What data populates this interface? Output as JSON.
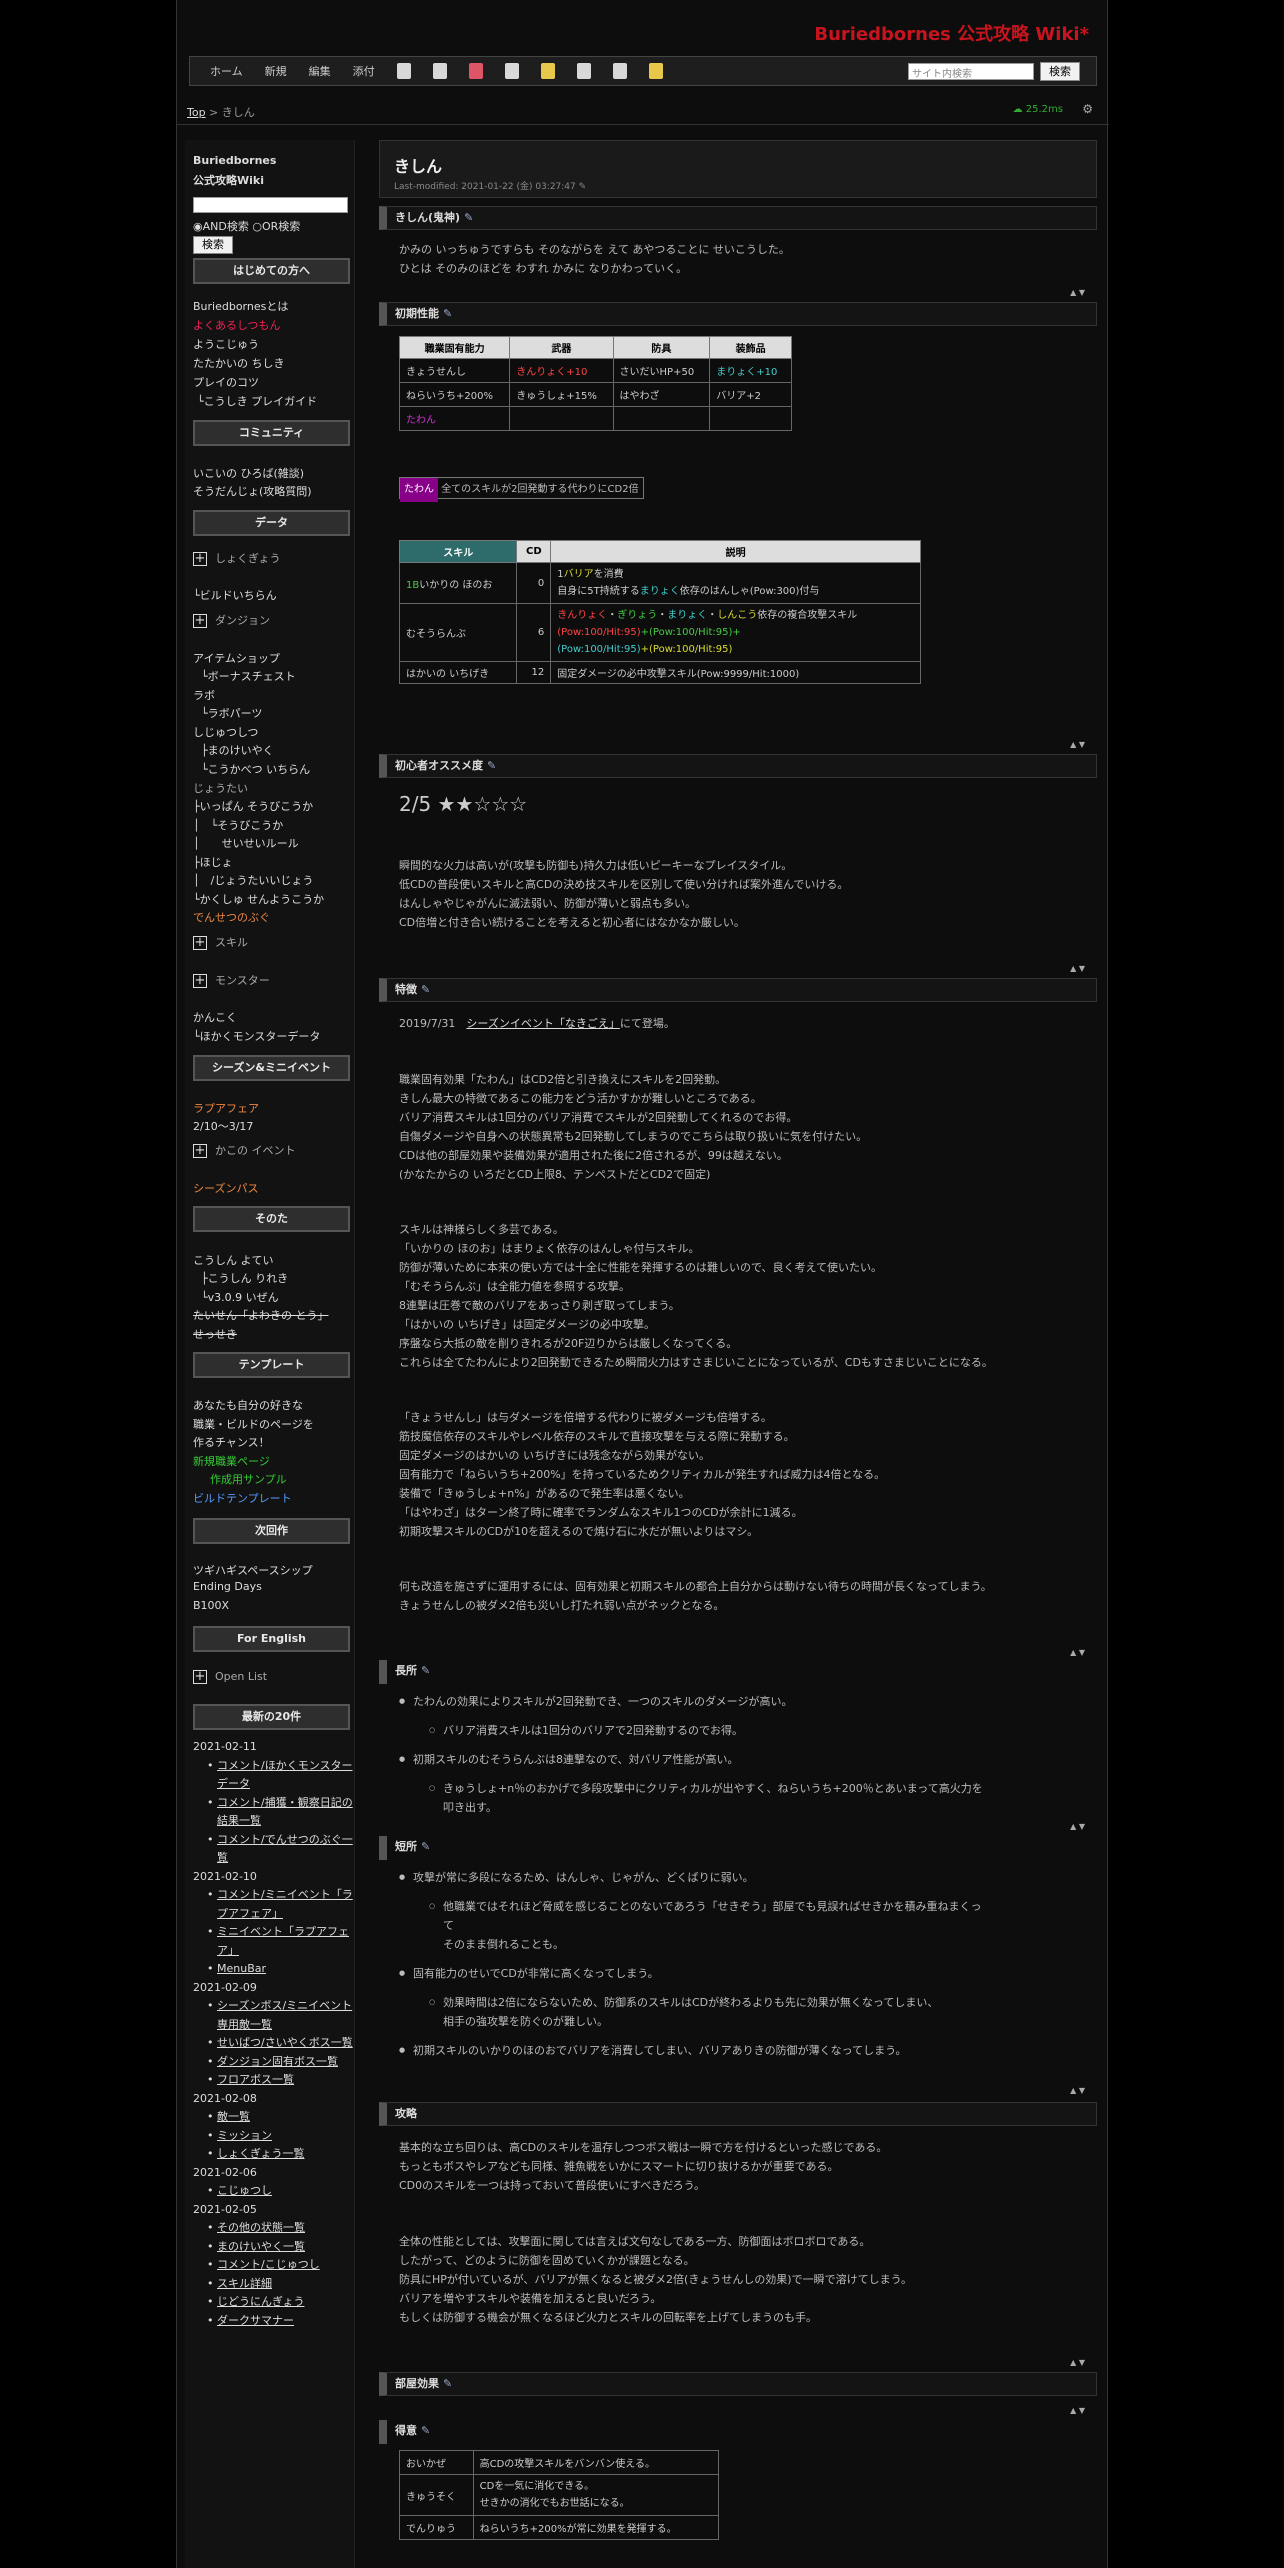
{
  "site_title": "Buriedbornes 公式攻略 Wiki*",
  "nav": {
    "links": [
      "ホーム",
      "新規",
      "編集",
      "添付"
    ],
    "search_placeholder": "サイト内検索",
    "search_button": "検索"
  },
  "breadcrumb": {
    "top": "Top",
    "sep": " > ",
    "current": "きしん"
  },
  "perf": "25.2ms",
  "sidebar": {
    "wiki_name1": "Buriedbornes",
    "wiki_name2": "公式攻略Wiki",
    "and_label": "AND検索",
    "or_label": "OR検索",
    "search_btn": "検索",
    "sec_beginner": "はじめての方へ",
    "beginner": [
      "Buriedbornesとは",
      "よくあるしつもん",
      "ようこじゅう",
      "たたかいの ちしき",
      "プレイのコツ",
      "└こうしき プレイガイド"
    ],
    "sec_community": "コミュニティ",
    "community": [
      "いこいの ひろば(雑談)",
      "そうだんじょ(攻略質問)"
    ],
    "sec_data": "データ",
    "data_items": [
      "しょくぎょう",
      "└ビルドいちらん",
      "ダンジョン",
      "アイテムショップ",
      "└ボーナスチェスト",
      "ラボ",
      "└ラボパーツ",
      "しじゅつしつ",
      "├まのけいやく",
      "└こうかべつ いちらん",
      "じょうたい",
      "├いっぱん そうびこうか",
      "│　└そうびこうか",
      "│　　せいせいルール",
      "├ほじょ",
      "│　/じょうたいいじょう",
      "└かくしゅ せんようこうか",
      "でんせつのぶぐ",
      "スキル",
      "モンスター",
      "かんこく",
      "└ほかくモンスターデータ"
    ],
    "sec_season": "シーズン&ミニイベント",
    "season": [
      "ラプアフェア",
      "2/10～3/17",
      "かこの イベント",
      "シーズンパス"
    ],
    "sec_other": "そのた",
    "other": [
      "こうしん よてい",
      "├こうしん りれき",
      "└v3.0.9 いぜん",
      "たいせん「よわきの とう」",
      "せっせき"
    ],
    "sec_template": "テンプレート",
    "template": [
      "あなたも自分の好きな",
      "職業・ビルドのページを",
      "作るチャンス！",
      "新規職業ページ",
      "　作成用サンプル",
      "ビルドテンプレート"
    ],
    "sec_next": "次回作",
    "next": [
      "ツギハギスペースシップ",
      "Ending Days",
      "B100X"
    ],
    "sec_english": "For English",
    "english": [
      "Open List"
    ],
    "sec_latest": "最新の20件",
    "latest": [
      {
        "date": "2021-02-11",
        "items": [
          "コメント/ほかくモンスターデータ",
          "コメント/捕獲・観察日記の結果一覧",
          "コメント/でんせつのぶぐ一覧"
        ]
      },
      {
        "date": "2021-02-10",
        "items": [
          "コメント/ミニイベント「ラプアフェア」",
          "ミニイベント「ラプアフェア」",
          "MenuBar"
        ]
      },
      {
        "date": "2021-02-09",
        "items": [
          "シーズンボス/ミニイベント専用敵一覧",
          "せいばつ/さいやくボス一覧",
          "ダンジョン固有ボス一覧",
          "フロアボス一覧"
        ]
      },
      {
        "date": "2021-02-08",
        "items": [
          "敵一覧",
          "ミッション",
          "しょくぎょう一覧"
        ]
      },
      {
        "date": "2021-02-06",
        "items": [
          "こじゅつし"
        ]
      },
      {
        "date": "2021-02-05",
        "items": [
          "その他の状態一覧",
          "まのけいやく一覧",
          "コメント/こじゅつし",
          "スキル詳細",
          "じどうにんぎょう",
          "ダークサマナー"
        ]
      }
    ]
  },
  "page": {
    "title": "きしん",
    "modified": "Last-modified: 2021-01-22 (金) 03:27:47",
    "h_kishin": "きしん(鬼神)",
    "intro": [
      "かみの いっちゅうですらも そのながらを えて あやつることに せいこうした。",
      "ひとは そのみのほどを わすれ かみに なりかわっていく。"
    ],
    "h_init": "初期性能",
    "init_table": {
      "headers": [
        "職業固有能力",
        "武器",
        "防具",
        "装飾品"
      ],
      "rows": [
        [
          "きょうせんし",
          "きんりょく+10",
          "さいだいHP+50",
          "まりょく+10"
        ],
        [
          "ねらいうち+200%",
          "きゅうしょ+15%",
          "はやわざ",
          "バリア+2"
        ],
        [
          "たわん",
          "",
          "",
          ""
        ]
      ]
    },
    "tawan_tag": "たわん",
    "tawan_desc": "全てのスキルが2回発動する代わりにCD2倍",
    "skill_table": {
      "headers": [
        "スキル",
        "CD",
        "説明"
      ],
      "rows": [
        {
          "name_pre": "1B",
          "name": "いかりの ほのお",
          "cd": "0",
          "d1a": "1",
          "d1b": "バリア",
          "d1c": "を消費",
          "d2a": "自身に5T持続する",
          "d2b": "まりょく",
          "d2c": "依存のはんしゃ(Pow:300)付与"
        },
        {
          "name": "むそうらんぶ",
          "cd": "6",
          "d1a": "きんりょく",
          "d1b": "・",
          "d1c": "ぎりょう",
          "d1d": "・",
          "d1e": "まりょく",
          "d1f": "・",
          "d1g": "しんこう",
          "d1h": "依存の複合攻撃スキル",
          "d2a": "(Pow:100/Hit:95)",
          "d2b": "+(Pow:100/Hit:95)+",
          "d3a": "(Pow:100/Hit:95)",
          "d3b": "+(Pow:100/Hit:95)"
        },
        {
          "name": "はかいの いちげき",
          "cd": "12",
          "d1a": "固定ダメージの必中攻撃スキル(Pow:9999/Hit:1000)"
        }
      ]
    },
    "h_rec": "初心者オススメ度",
    "rec_score": "2/5",
    "rec_stars": "★★☆☆☆",
    "rec_text": [
      "瞬間的な火力は高いが(攻撃も防御も)持久力は低いピーキーなプレイスタイル。",
      "低CDの普段使いスキルと高CDの決め技スキルを区別して使い分ければ案外進んでいける。",
      "はんしゃやじゃがんに滅法弱い、防御が薄いと弱点も多い。",
      "CD倍増と付き合い続けることを考えると初心者にはなかなか厳しい。"
    ],
    "h_feat": "特徴",
    "feat_date": "2019/7/31",
    "feat_link": "シーズンイベント「なきごえ」",
    "feat_tail": "にて登場。",
    "feat_p1": [
      "職業固有効果「たわん」はCD2倍と引き換えにスキルを2回発動。",
      "きしん最大の特徴であるこの能力をどう活かすかが難しいところである。",
      "バリア消費スキルは1回分のバリア消費でスキルが2回発動してくれるのでお得。",
      "自傷ダメージや自身への状態異常も2回発動してしまうのでこちらは取り扱いに気を付けたい。",
      "CDは他の部屋効果や装備効果が適用された後に2倍されるが、99は越えない。",
      "(かなたからの いろだとCD上限8、テンペストだとCD2で固定)"
    ],
    "feat_p2": [
      "スキルは神様らしく多芸である。",
      "「いかりの ほのお」はまりょく依存のはんしゃ付与スキル。",
      "防御が薄いために本来の使い方では十全に性能を発揮するのは難しいので、良く考えて使いたい。",
      "「むそうらんぶ」は全能力値を参照する攻撃。",
      "8連撃は圧巻で敵のバリアをあっさり剥ぎ取ってしまう。",
      "「はかいの いちげき」は固定ダメージの必中攻撃。",
      "序盤なら大抵の敵を削りきれるが20F辺りからは厳しくなってくる。",
      "これらは全てたわんにより2回発動できるため瞬間火力はすさまじいことになっているが、CDもすさまじいことになる。"
    ],
    "feat_p3": [
      "「きょうせんし」は与ダメージを倍増する代わりに被ダメージも倍増する。",
      "筋技魔信依存のスキルやレベル依存のスキルで直接攻撃を与える際に発動する。",
      "固定ダメージのはかいの いちげきには残念ながら効果がない。",
      "固有能力で「ねらいうち+200%」を持っているためクリティカルが発生すれば威力は4倍となる。",
      "装備で「きゅうしょ+n%」があるので発生率は悪くない。",
      "「はやわざ」はターン終了時に確率でランダムなスキル1つのCDが余計に1減る。",
      "初期攻撃スキルのCDが10を超えるので焼け石に水だが無いよりはマシ。"
    ],
    "feat_p4": [
      "何も改造を施さずに運用するには、固有効果と初期スキルの都合上自分からは動けない待ちの時間が長くなってしまう。",
      "きょうせんしの被ダメ2倍も災いし打たれ弱い点がネックとなる。"
    ],
    "h_pros": "長所",
    "pros": [
      {
        "t": "たわんの効果によりスキルが2回発動でき、一つのスキルのダメージが高い。",
        "subs": [
          "バリア消費スキルは1回分のバリアで2回発動するのでお得。"
        ]
      },
      {
        "t": "初期スキルのむそうらんぶは8連撃なので、対バリア性能が高い。",
        "subs": [
          "きゅうしょ+n％のおかげで多段攻撃中にクリティカルが出やすく、ねらいうち+200％とあいまって高火力を",
          "叩き出す。"
        ]
      }
    ],
    "h_cons": "短所",
    "cons": [
      {
        "t": "攻撃が常に多段になるため、はんしゃ、じゃがん、どくばりに弱い。",
        "subs": [
          "他職業ではそれほど脅威を感じることのないであろう「せきぞう」部屋でも見誤ればせきかを積み重ねまくっ",
          "て",
          "そのまま倒れることも。"
        ]
      },
      {
        "t": "固有能力のせいでCDが非常に高くなってしまう。",
        "subs": [
          "効果時間は2倍にならないため、防御系のスキルはCDが終わるよりも先に効果が無くなってしまい、",
          "相手の強攻撃を防ぐのが難しい。"
        ]
      },
      {
        "t": "初期スキルのいかりのほのおでバリアを消費してしまい、バリアありきの防御が薄くなってしまう。",
        "subs": []
      }
    ],
    "h_strat": "攻略",
    "strat_p1": [
      "基本的な立ち回りは、高CDのスキルを温存しつつボス戦は一瞬で方を付けるといった感じである。",
      "もっともボスやレアなども同様、雑魚戦をいかにスマートに切り抜けるかが重要である。",
      "CD0のスキルを一つは持っておいて普段使いにすべきだろう。"
    ],
    "strat_p2": [
      "全体の性能としては、攻撃面に関しては言えば文句なしである一方、防御面はボロボロである。",
      "したがって、どのように防御を固めていくかが課題となる。",
      "防具にHPが付いているが、バリアが無くなると被ダメ2倍(きょうせんしの効果)で一瞬で溶けてしまう。",
      "バリアを増やすスキルや装備を加えると良いだろう。",
      "もしくは防御する機会が無くなるほど火力とスキルの回転率を上げてしまうのも手。"
    ],
    "h_room": "部屋効果",
    "h_good": "得意",
    "good_table": [
      [
        "おいかぜ",
        "高CDの攻撃スキルをバンバン使える。"
      ],
      [
        "きゅうそく",
        "CDを一気に消化できる。",
        "せきかの消化でもお世話になる。"
      ],
      [
        "でんりゅう",
        "ねらいうち+200%が常に効果を発揮する。"
      ]
    ]
  }
}
